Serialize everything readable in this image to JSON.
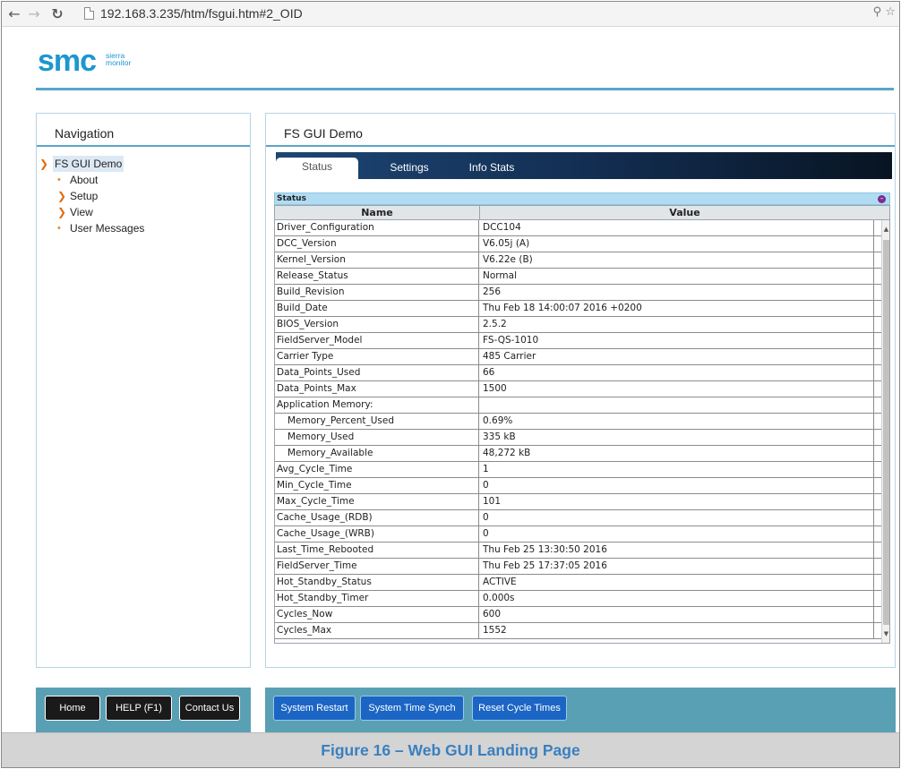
{
  "browser": {
    "url": "192.168.3.235/htm/fsgui.htm#2_OID",
    "back_icon": "arrow-left-icon",
    "forward_icon": "arrow-right-icon",
    "reload_icon": "reload-icon"
  },
  "logo": {
    "brand": "smc",
    "sub_line1": "sierra",
    "sub_line2": "monitor",
    "color": "#1c97cf"
  },
  "navigation": {
    "title": "Navigation",
    "items": [
      {
        "label": "FS GUI Demo",
        "type": "expanded",
        "selected": true
      },
      {
        "label": "About",
        "type": "leaf"
      },
      {
        "label": "Setup",
        "type": "collapsed"
      },
      {
        "label": "View",
        "type": "collapsed"
      },
      {
        "label": "User Messages",
        "type": "leaf"
      }
    ]
  },
  "main": {
    "title": "FS GUI Demo",
    "tabs": [
      {
        "label": "Status",
        "active": true
      },
      {
        "label": "Settings",
        "active": false
      },
      {
        "label": "Info Stats",
        "active": false
      }
    ],
    "status_section": "Status",
    "columns": [
      "Name",
      "Value"
    ],
    "rows": [
      [
        "Driver_Configuration",
        "DCC104"
      ],
      [
        "DCC_Version",
        "V6.05j (A)"
      ],
      [
        "Kernel_Version",
        "V6.22e (B)"
      ],
      [
        "Release_Status",
        "Normal"
      ],
      [
        "Build_Revision",
        "256"
      ],
      [
        "Build_Date",
        "Thu Feb 18 14:00:07 2016 +0200"
      ],
      [
        "BIOS_Version",
        "2.5.2"
      ],
      [
        "FieldServer_Model",
        "FS-QS-1010"
      ],
      [
        "Carrier Type",
        "485 Carrier"
      ],
      [
        "Data_Points_Used",
        "66"
      ],
      [
        "Data_Points_Max",
        "1500"
      ],
      [
        "Application Memory:",
        ""
      ],
      [
        "Memory_Percent_Used",
        "0.69%"
      ],
      [
        "Memory_Used",
        "335 kB"
      ],
      [
        "Memory_Available",
        "48,272 kB"
      ],
      [
        "Avg_Cycle_Time",
        "1"
      ],
      [
        "Min_Cycle_Time",
        "0"
      ],
      [
        "Max_Cycle_Time",
        "101"
      ],
      [
        "Cache_Usage_(RDB)",
        "0"
      ],
      [
        "Cache_Usage_(WRB)",
        "0"
      ],
      [
        "Last_Time_Rebooted",
        "Thu Feb 25 13:30:50 2016"
      ],
      [
        "FieldServer_Time",
        "Thu Feb 25 17:37:05 2016"
      ],
      [
        "Hot_Standby_Status",
        "ACTIVE"
      ],
      [
        "Hot_Standby_Timer",
        "0.000s"
      ],
      [
        "Cycles_Now",
        "600"
      ],
      [
        "Cycles_Max",
        "1552"
      ]
    ],
    "indented_rows": [
      12,
      13,
      14
    ]
  },
  "footer_left": {
    "buttons": [
      "Home",
      "HELP (F1)",
      "Contact Us"
    ]
  },
  "footer_right": {
    "buttons": [
      "System Restart",
      "System Time Synch",
      "Reset Cycle Times"
    ]
  },
  "caption": "Figure 16 – Web GUI Landing Page",
  "colors": {
    "accent": "#5aa6c8",
    "footer": "#5aa0b5",
    "tab_bar": "#122c4f",
    "status_header": "#b0dcf3",
    "caption_text": "#3a7fc0"
  }
}
